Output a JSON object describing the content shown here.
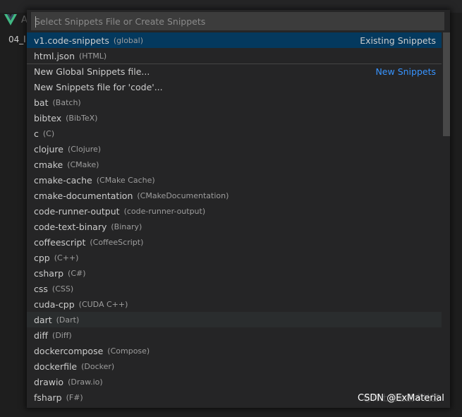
{
  "background": {
    "tab_text": "A",
    "side_label": "04_l"
  },
  "quick_input": {
    "placeholder": "Select Snippets File or Create Snippets",
    "items": [
      {
        "label": "v1.code-snippets",
        "description": "(global)",
        "separator_label": "Existing Snippets"
      },
      {
        "label": "html.json",
        "description": "(HTML)"
      },
      {
        "label": "New Global Snippets file...",
        "description": "",
        "separator_label": "New Snippets"
      },
      {
        "label": "New Snippets file for 'code'...",
        "description": ""
      },
      {
        "label": "bat",
        "description": "(Batch)"
      },
      {
        "label": "bibtex",
        "description": "(BibTeX)"
      },
      {
        "label": "c",
        "description": "(C)"
      },
      {
        "label": "clojure",
        "description": "(Clojure)"
      },
      {
        "label": "cmake",
        "description": "(CMake)"
      },
      {
        "label": "cmake-cache",
        "description": "(CMake Cache)"
      },
      {
        "label": "cmake-documentation",
        "description": "(CMakeDocumentation)"
      },
      {
        "label": "code-runner-output",
        "description": "(code-runner-output)"
      },
      {
        "label": "code-text-binary",
        "description": "(Binary)"
      },
      {
        "label": "coffeescript",
        "description": "(CoffeeScript)"
      },
      {
        "label": "cpp",
        "description": "(C++)"
      },
      {
        "label": "csharp",
        "description": "(C#)"
      },
      {
        "label": "css",
        "description": "(CSS)"
      },
      {
        "label": "cuda-cpp",
        "description": "(CUDA C++)"
      },
      {
        "label": "dart",
        "description": "(Dart)"
      },
      {
        "label": "diff",
        "description": "(Diff)"
      },
      {
        "label": "dockercompose",
        "description": "(Compose)"
      },
      {
        "label": "dockerfile",
        "description": "(Docker)"
      },
      {
        "label": "drawio",
        "description": "(Draw.io)"
      },
      {
        "label": "fsharp",
        "description": "(F#)"
      }
    ]
  },
  "watermark": {
    "text": "CSDN @ExMaterial",
    "faint_text": "@稀土掘金技术社区"
  },
  "colors": {
    "background": "#1e1e1e",
    "widget": "#252526",
    "active_row": "#04395e",
    "hover_row": "#2a2d2e",
    "link": "#3794ff",
    "vue_green": "#41b883"
  }
}
